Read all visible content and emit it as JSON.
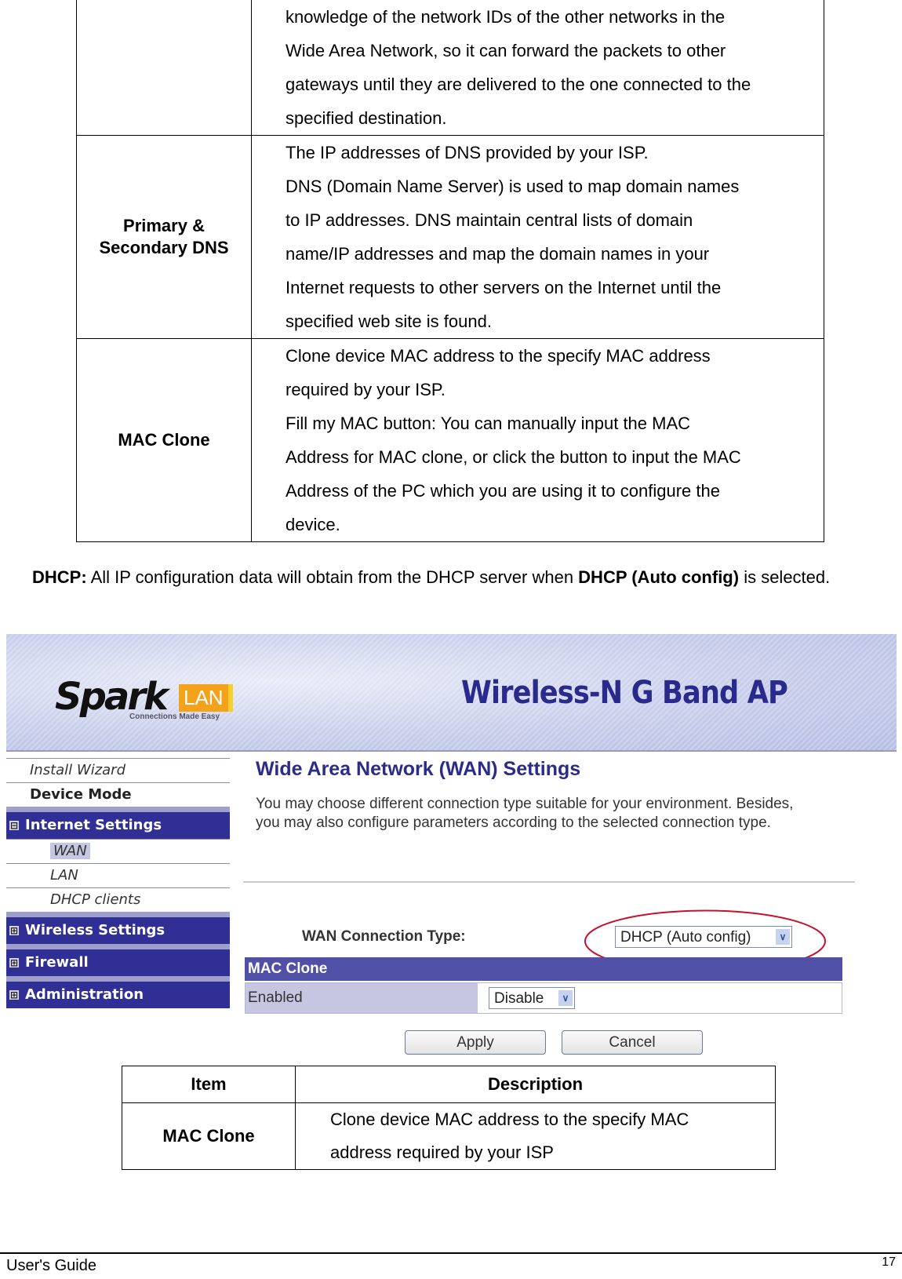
{
  "top_table": {
    "rows": [
      {
        "item": "",
        "description": [
          "knowledge of the network IDs of the other networks in the",
          "Wide Area Network, so it can forward the packets to other",
          "gateways until they are delivered to the one connected to the",
          "specified destination."
        ]
      },
      {
        "item": "Primary & Secondary DNS",
        "description": [
          "The IP addresses of DNS provided by your ISP.",
          "DNS (Domain Name Server) is used to map domain names",
          "to IP addresses. DNS maintain central lists of domain",
          "name/IP addresses and map the domain names in your",
          "Internet requests to other servers on the Internet until the",
          "specified web site is found."
        ]
      },
      {
        "item": "MAC Clone",
        "description": [
          "Clone device MAC address to the specify MAC address",
          "required by your ISP.",
          "Fill my MAC button: You can manually input the MAC",
          "Address for MAC clone, or click the button to input the MAC",
          "Address of the PC which you are using it to configure the",
          "device."
        ]
      }
    ]
  },
  "dhcp_paragraph": {
    "lead_bold": "DHCP:",
    "text_before": " All IP configuration data will obtain from the DHCP server when ",
    "bold_term": "DHCP (Auto config)",
    "text_after": " is selected."
  },
  "screenshot": {
    "brand": {
      "logo_text": "Spark",
      "logo_badge": "LAN",
      "tagline": "Connections Made Easy",
      "product_title": "Wireless-N G Band AP"
    },
    "sidebar": {
      "items": [
        {
          "label": "Install Wizard",
          "type": "link"
        },
        {
          "label": "Device Mode",
          "type": "link"
        }
      ],
      "sections": [
        {
          "label": "Internet Settings",
          "expanded": true,
          "toggle_icon": "⊟",
          "children": [
            {
              "label": "WAN",
              "active": true
            },
            {
              "label": "LAN",
              "active": false
            },
            {
              "label": "DHCP clients",
              "active": false
            }
          ]
        },
        {
          "label": "Wireless Settings",
          "expanded": false,
          "toggle_icon": "⊞"
        },
        {
          "label": "Firewall",
          "expanded": false,
          "toggle_icon": "⊞"
        },
        {
          "label": "Administration",
          "expanded": false,
          "toggle_icon": "⊞"
        }
      ]
    },
    "main": {
      "title": "Wide Area Network (WAN) Settings",
      "intro": "You may choose different connection type suitable for your environment. Besides, you may also configure parameters according to the selected connection type.",
      "wan_connection_label": "WAN Connection Type:",
      "wan_connection_value": "DHCP (Auto config)",
      "mac_clone_header": "MAC Clone",
      "mac_clone_row_label": "Enabled",
      "mac_clone_value": "Disable",
      "apply_label": "Apply",
      "cancel_label": "Cancel",
      "highlight_color": "#c8102e"
    }
  },
  "item_table": {
    "headers": [
      "Item",
      "Description"
    ],
    "rows": [
      {
        "item": "MAC Clone",
        "description": [
          "Clone device MAC address to the specify MAC",
          "address required by your ISP"
        ]
      }
    ]
  },
  "footer": {
    "left": "User's Guide",
    "page_number": "17"
  }
}
